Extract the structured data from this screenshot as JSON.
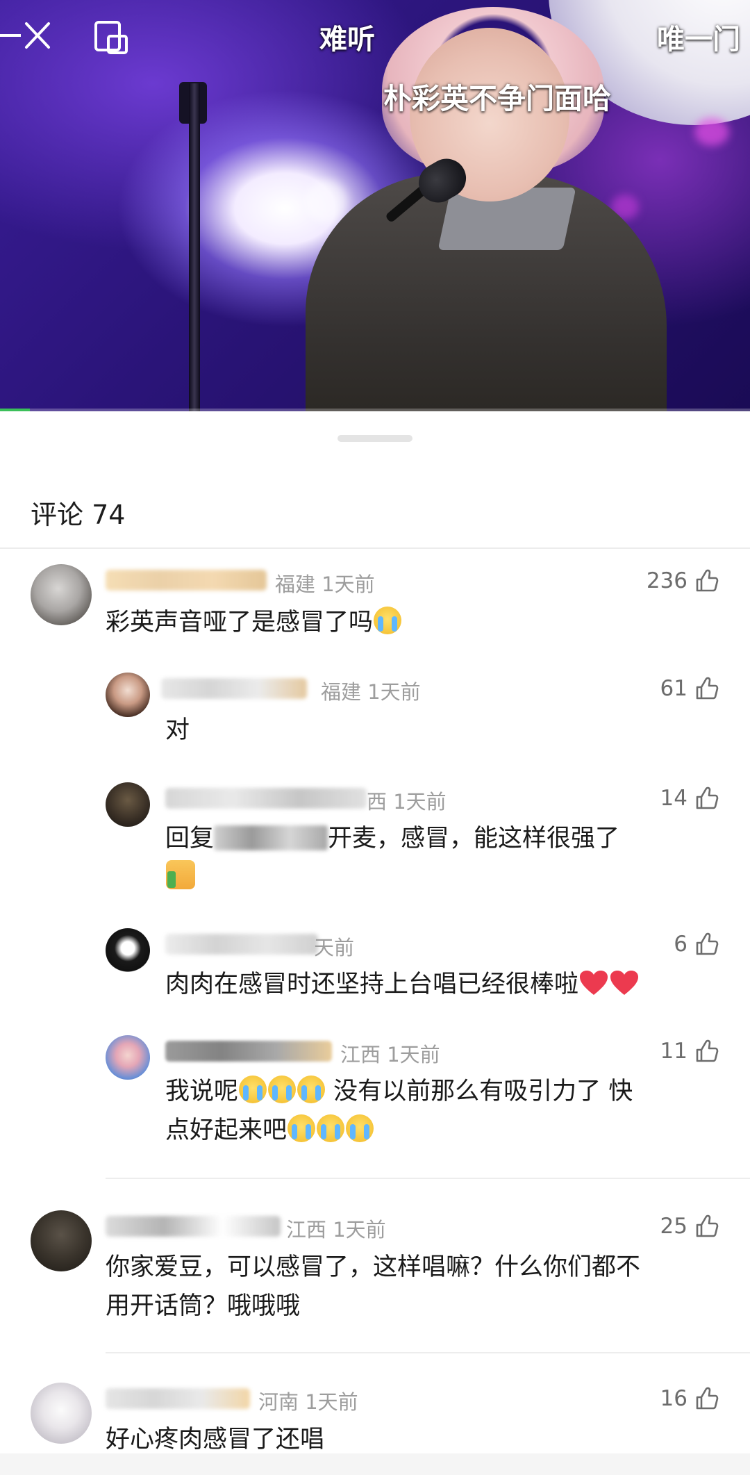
{
  "video": {
    "title": "难听",
    "subtitle": "朴彩英不争门面哈",
    "side_right": "唯一门",
    "progress": 0.04,
    "accent_color": "#3bbf5a"
  },
  "comments_header": {
    "label": "评论 74"
  },
  "comments": [
    {
      "meta": "福建 1天前",
      "likes": "236",
      "text": "彩英声音哑了是感冒了吗",
      "emoji_after": "loudly-crying-face",
      "replies": [
        {
          "meta": "福建 1天前",
          "likes": "61",
          "text": "对"
        },
        {
          "meta": "西 1天前",
          "likes": "14",
          "text": "回复",
          "text2": "开麦，感冒，能这样很强了",
          "emoji": "thumbs-up"
        },
        {
          "meta": "天前",
          "likes": "6",
          "text": "肉肉在感冒时还坚持上台唱已经很棒啦",
          "emoji": "red-heart"
        },
        {
          "meta": "江西 1天前",
          "likes": "11",
          "text_a": "我说呢",
          "text_b": " 没有以前那么有吸引力了 快",
          "text_c": "点好起来吧",
          "emoji": "loudly-crying-face"
        }
      ]
    },
    {
      "meta": "江西 1天前",
      "likes": "25",
      "text_line1": "你家爱豆，可以感冒了，这样唱嘛？什么你们都不",
      "text_line2": "用开话筒？哦哦哦"
    },
    {
      "meta": "河南 1天前",
      "likes": "16",
      "text": "好心疼肉感冒了还唱"
    }
  ],
  "icons": {
    "close": "close-icon",
    "pip": "picture-in-picture-icon",
    "like": "thumbs-up-outline-icon"
  }
}
